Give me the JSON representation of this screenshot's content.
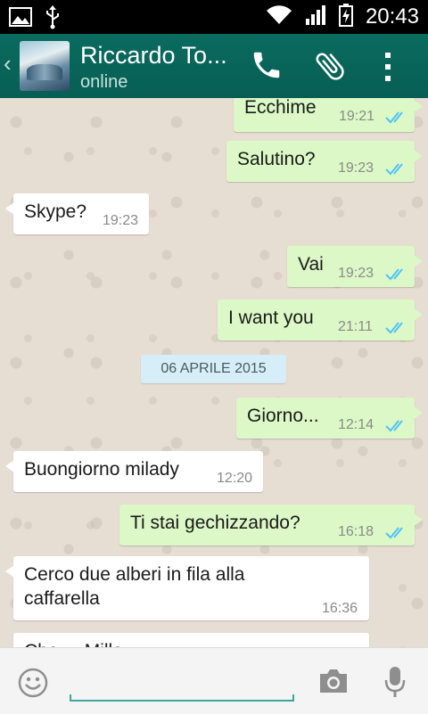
{
  "status_bar": {
    "time": "20:43"
  },
  "header": {
    "back_glyph": "‹",
    "contact_name": "Riccardo To...",
    "contact_status": "online",
    "icons": [
      "phone-icon",
      "paperclip-icon",
      "overflow-menu-icon"
    ]
  },
  "date_separator": "06 APRILE 2015",
  "messages": [
    {
      "direction": "out",
      "text": "Ecchime",
      "time": "19:21",
      "read": true
    },
    {
      "direction": "out",
      "text": "Salutino?",
      "time": "19:23",
      "read": true
    },
    {
      "direction": "in",
      "text": "Skype?",
      "time": "19:23"
    },
    {
      "direction": "out",
      "text": "Vai",
      "time": "19:23",
      "read": true
    },
    {
      "direction": "out",
      "text": "I want you",
      "time": "21:11",
      "read": true
    },
    {
      "direction": "out",
      "text": "Giorno...",
      "time": "12:14",
      "read": true
    },
    {
      "direction": "in",
      "text": "Buongiorno milady",
      "time": "12:20"
    },
    {
      "direction": "out",
      "text": "Ti stai gechizzando?",
      "time": "16:18",
      "read": true
    },
    {
      "direction": "in",
      "text": "Cerco due alberi in fila alla caffarella",
      "time": "16:36"
    },
    {
      "direction": "in",
      "text": "Che ... Mille ...",
      "time": ""
    }
  ],
  "composer": {
    "placeholder": "",
    "icons": [
      "emoji-icon",
      "camera-icon",
      "microphone-icon"
    ]
  },
  "colors": {
    "header": "#075e54",
    "outgoing_bubble": "#dcf8c6",
    "incoming_bubble": "#ffffff",
    "read_ticks": "#4fc3f7",
    "date_pill": "#d5eef7"
  }
}
